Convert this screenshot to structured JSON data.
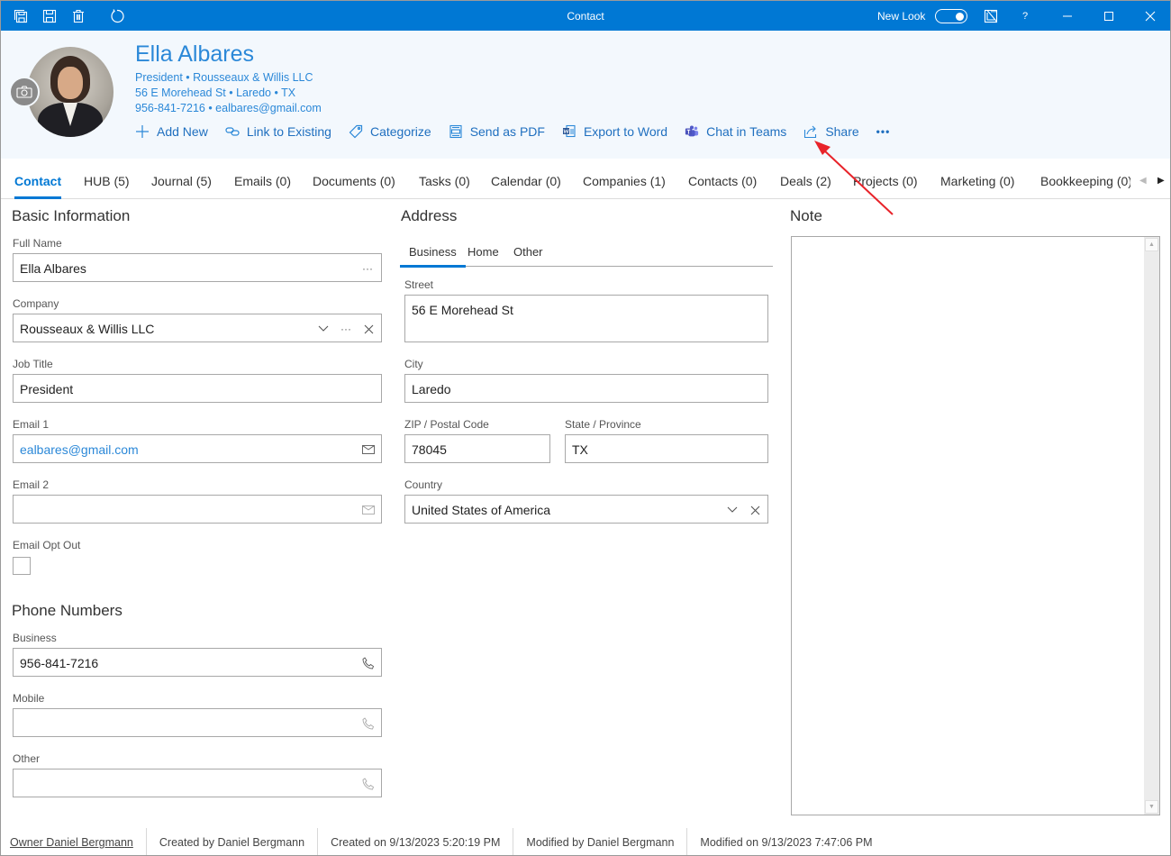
{
  "titlebar": {
    "title": "Contact",
    "new_look_label": "New Look",
    "new_look_on": true,
    "help_label": "?",
    "icons": [
      "save-all-icon",
      "save-icon",
      "delete-icon",
      "refresh-icon",
      "ruler-icon",
      "help-icon",
      "minimize-icon",
      "maximize-icon",
      "close-icon"
    ]
  },
  "header": {
    "name": "Ella Albares",
    "line1": "President • Rousseaux & Willis LLC",
    "line2": "56 E Morehead St • Laredo • TX",
    "line3": "956-841-7216 • ealbares@gmail.com",
    "actions": [
      {
        "label": "Add New",
        "icon": "plus-icon"
      },
      {
        "label": "Link to Existing",
        "icon": "link-icon"
      },
      {
        "label": "Categorize",
        "icon": "tag-icon"
      },
      {
        "label": "Send as PDF",
        "icon": "pdf-icon"
      },
      {
        "label": "Export to Word",
        "icon": "word-icon"
      },
      {
        "label": "Chat in Teams",
        "icon": "teams-icon"
      },
      {
        "label": "Share",
        "icon": "share-icon"
      }
    ],
    "more_label": "•••"
  },
  "tabs": [
    {
      "label": "Contact",
      "active": true
    },
    {
      "label": "HUB (5)"
    },
    {
      "label": "Journal (5)"
    },
    {
      "label": "Emails (0)"
    },
    {
      "label": "Documents (0)"
    },
    {
      "label": "Tasks (0)"
    },
    {
      "label": "Calendar (0)"
    },
    {
      "label": "Companies (1)"
    },
    {
      "label": "Contacts (0)"
    },
    {
      "label": "Deals (2)"
    },
    {
      "label": "Projects (0)"
    },
    {
      "label": "Marketing (0)"
    },
    {
      "label": "Bookkeeping (0)"
    }
  ],
  "basic": {
    "title": "Basic Information",
    "full_name_label": "Full Name",
    "full_name": "Ella Albares",
    "company_label": "Company",
    "company": "Rousseaux & Willis LLC",
    "job_title_label": "Job Title",
    "job_title": "President",
    "email1_label": "Email 1",
    "email1": "ealbares@gmail.com",
    "email2_label": "Email 2",
    "email2": "",
    "opt_out_label": "Email Opt Out",
    "opt_out": false
  },
  "phones": {
    "title": "Phone Numbers",
    "business_label": "Business",
    "business": "956-841-7216",
    "mobile_label": "Mobile",
    "mobile": "",
    "other_label": "Other",
    "other": ""
  },
  "address": {
    "title": "Address",
    "tabs": [
      {
        "label": "Business",
        "active": true
      },
      {
        "label": "Home"
      },
      {
        "label": "Other"
      }
    ],
    "street_label": "Street",
    "street": "56 E Morehead St",
    "city_label": "City",
    "city": "Laredo",
    "zip_label": "ZIP / Postal Code",
    "zip": "78045",
    "state_label": "State / Province",
    "state": "TX",
    "country_label": "Country",
    "country": "United States of America"
  },
  "note": {
    "title": "Note",
    "text": ""
  },
  "footer": {
    "owner": "Owner Daniel Bergmann",
    "created_by": "Created by Daniel Bergmann",
    "created_on": "Created on 9/13/2023 5:20:19 PM",
    "modified_by": "Modified by Daniel Bergmann",
    "modified_on": "Modified on 9/13/2023 7:47:06 PM"
  },
  "colors": {
    "accent": "#0078d4",
    "link": "#2b88d8",
    "header_bg": "#f3f8fd",
    "annotation_arrow": "#e8232a"
  }
}
